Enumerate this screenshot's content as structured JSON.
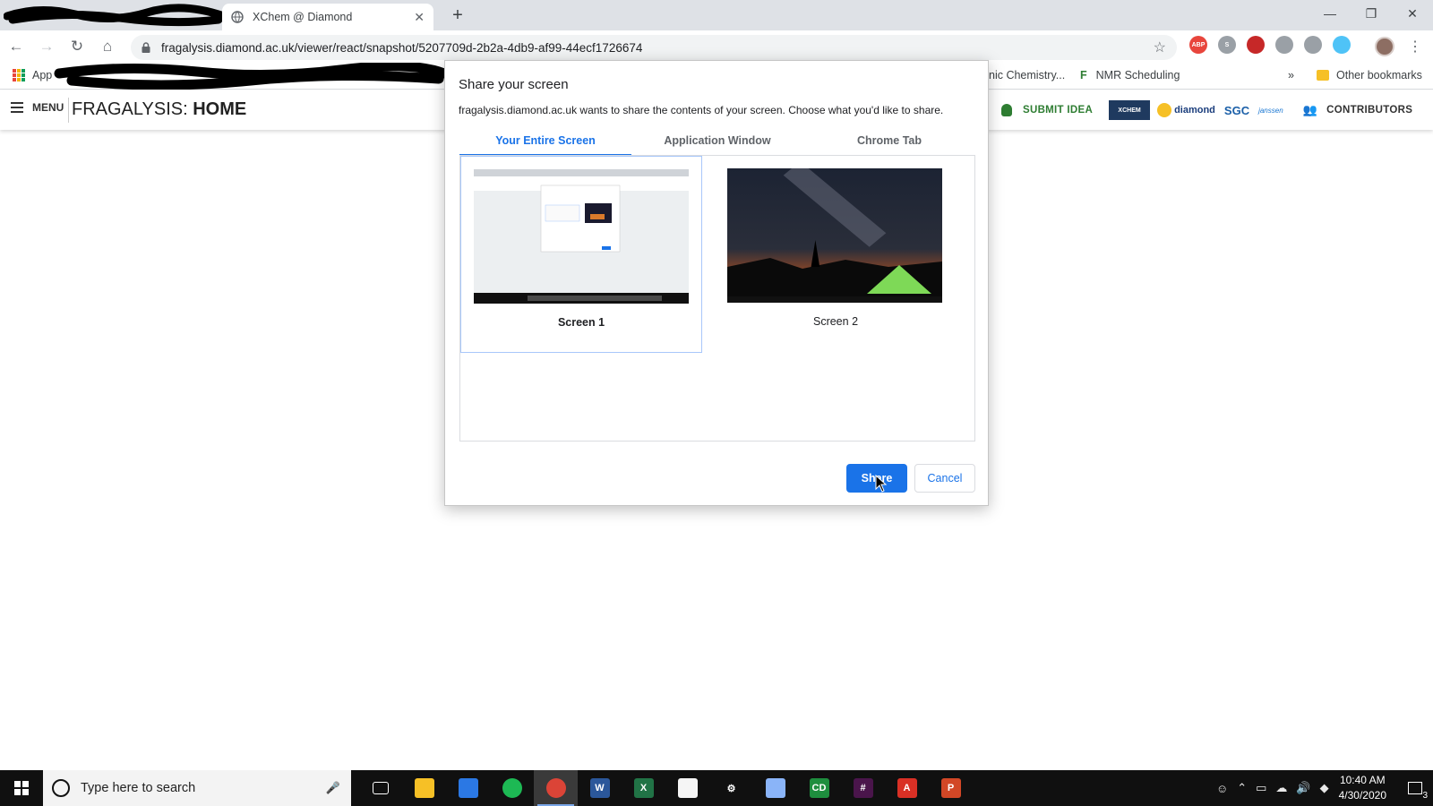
{
  "browser": {
    "tab": {
      "title": "XChem @ Diamond"
    },
    "url": "fragalysis.diamond.ac.uk/viewer/react/snapshot/5207709d-2b2a-4db9-af99-44ecf1726674",
    "bookmarks": {
      "apps_label": "App",
      "items": [
        "nic Chemistry...",
        "NMR Scheduling"
      ],
      "overflow": "»",
      "other": "Other bookmarks"
    },
    "extensions": [
      {
        "icon": "adblock-icon",
        "label": "ABP",
        "color": "#e8453c"
      },
      {
        "icon": "skype-icon",
        "label": "S",
        "color": "#9aa0a6"
      },
      {
        "icon": "flag-icon",
        "label": "",
        "color": "#c62828"
      },
      {
        "icon": "dropbox-icon",
        "label": "",
        "color": "#9aa0a6"
      },
      {
        "icon": "drive-icon",
        "label": "",
        "color": "#9aa0a6"
      },
      {
        "icon": "cloud-icon",
        "label": "",
        "color": "#4fc3f7"
      }
    ]
  },
  "app": {
    "menu_label": "MENU",
    "title_prefix": "FRAGALYSIS: ",
    "title_main": "HOME",
    "submit_label": "SUBMIT IDEA",
    "logos": [
      "XCHEM",
      "diamond",
      "SGC",
      "janssen"
    ],
    "contributors_label": "CONTRIBUTORS"
  },
  "dialog": {
    "title": "Share your screen",
    "description": "fragalysis.diamond.ac.uk wants to share the contents of your screen. Choose what you'd like to share.",
    "tabs": [
      {
        "label": "Your Entire Screen",
        "active": true
      },
      {
        "label": "Application Window",
        "active": false
      },
      {
        "label": "Chrome Tab",
        "active": false
      }
    ],
    "sources": [
      {
        "label": "Screen 1",
        "selected": true
      },
      {
        "label": "Screen 2",
        "selected": false
      }
    ],
    "share_label": "Share",
    "cancel_label": "Cancel"
  },
  "taskbar": {
    "search_placeholder": "Type here to search",
    "apps": [
      {
        "name": "task-view-icon",
        "label": "",
        "color": "#101010"
      },
      {
        "name": "file-explorer-icon",
        "label": "",
        "color": "#f6c026"
      },
      {
        "name": "store-icon",
        "label": "",
        "color": "#2b78e4"
      },
      {
        "name": "spotify-icon",
        "label": "",
        "color": "#1db954"
      },
      {
        "name": "chrome-icon",
        "label": "",
        "color": "#db4437"
      },
      {
        "name": "word-icon",
        "label": "W",
        "color": "#2b579a"
      },
      {
        "name": "excel-icon",
        "label": "X",
        "color": "#217346"
      },
      {
        "name": "sticky-notes-icon",
        "label": "",
        "color": "#f5f5f5"
      },
      {
        "name": "settings-icon",
        "label": "⚙",
        "color": "#101010"
      },
      {
        "name": "remote-desktop-icon",
        "label": "",
        "color": "#8ab4f8"
      },
      {
        "name": "chemdraw-icon",
        "label": "CD",
        "color": "#1e8e3e"
      },
      {
        "name": "slack-icon",
        "label": "#",
        "color": "#4a154b"
      },
      {
        "name": "acrobat-icon",
        "label": "A",
        "color": "#d93025"
      },
      {
        "name": "powerpoint-icon",
        "label": "P",
        "color": "#d24726"
      }
    ],
    "time": "10:40 AM",
    "date": "4/30/2020",
    "notification_count": "3"
  }
}
